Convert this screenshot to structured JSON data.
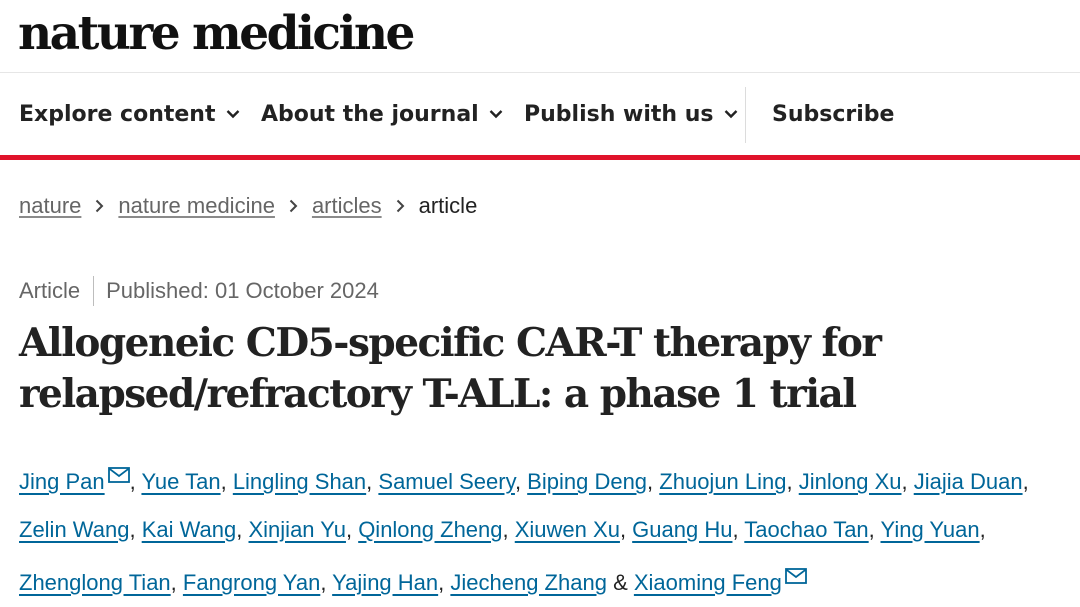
{
  "header": {
    "logo_text": "nature medicine"
  },
  "nav": {
    "explore": "Explore content",
    "about": "About the journal",
    "publish": "Publish with us",
    "subscribe": "Subscribe"
  },
  "breadcrumb": [
    "nature",
    "nature medicine",
    "articles",
    "article"
  ],
  "article": {
    "type": "Article",
    "published": "Published: 01 October 2024",
    "title": "Allogeneic CD5-specific CAR-T therapy for relapsed/refractory T-ALL: a phase 1 trial"
  },
  "authors": [
    "Jing Pan",
    "Yue Tan",
    "Lingling Shan",
    "Samuel Seery",
    "Biping Deng",
    "Zhuojun Ling",
    "Jinlong Xu",
    "Jiajia Duan",
    "Zelin Wang",
    "Kai Wang",
    "Xinjian Yu",
    "Qinlong Zheng",
    "Xiuwen Xu",
    "Guang Hu",
    "Taochao Tan",
    "Ying Yuan",
    "Zhenglong Tian",
    "Fangrong Yan",
    "Yajing Han",
    "Jiecheng Zhang",
    "Xiaoming Feng"
  ],
  "authors_final_joiner": "&",
  "colors": {
    "accent_red": "#e0132b",
    "link_blue": "#006699"
  },
  "icons": {
    "nav_dropdown": "chevron-down-icon",
    "breadcrumb_sep": "chevron-right-icon",
    "corresponding": "envelope-icon"
  }
}
